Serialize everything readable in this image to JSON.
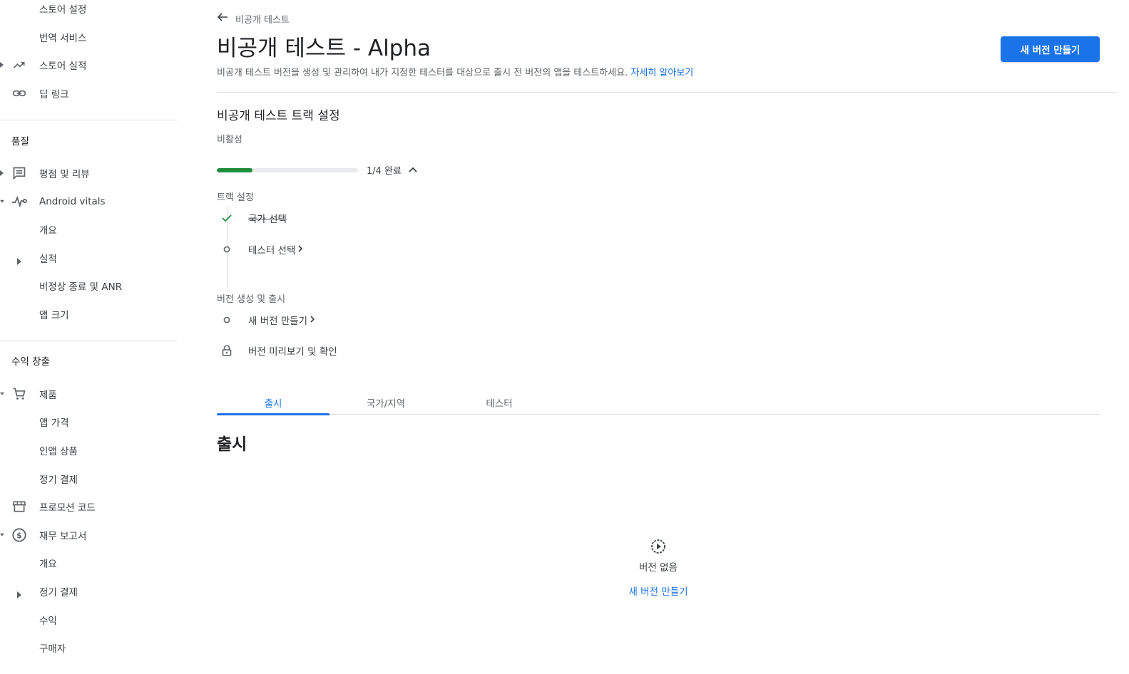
{
  "sidebar": {
    "items": [
      {
        "label": "스토어 설정"
      },
      {
        "label": "번역 서비스"
      },
      {
        "label": "스토어 실적"
      },
      {
        "label": "딥 링크"
      },
      {
        "label": "평점 및 리뷰"
      },
      {
        "label": "Android vitals"
      },
      {
        "label": "개요"
      },
      {
        "label": "실적"
      },
      {
        "label": "비정상 종료 및 ANR"
      },
      {
        "label": "앱 크기"
      },
      {
        "label": "제품"
      },
      {
        "label": "앱 가격"
      },
      {
        "label": "인앱 상품"
      },
      {
        "label": "정기 결제"
      },
      {
        "label": "프로모션 코드"
      },
      {
        "label": "재무 보고서"
      },
      {
        "label": "개요"
      },
      {
        "label": "정기 결제"
      },
      {
        "label": "수익"
      },
      {
        "label": "구매자"
      }
    ],
    "sections": {
      "quality": "품질",
      "monetization": "수익 창출"
    }
  },
  "header": {
    "back_label": "비공개 테스트",
    "title": "비공개 테스트 - Alpha",
    "description": "비공개 테스트 버전을 생성 및 관리하여 내가 지정한 테스터를 대상으로 출시 전 버전의 앱을 테스트하세요.",
    "learn_more": "자세히 알아보기",
    "create_button": "새 버전 만들기"
  },
  "track_setup": {
    "title": "비공개 테스트 트랙 설정",
    "status": "비활성",
    "progress_label": "1/4 완료",
    "progress_fraction": 0.25,
    "groups": [
      {
        "label": "트랙 설정",
        "steps": [
          {
            "label": "국가 선택",
            "state": "done"
          },
          {
            "label": "테스터 선택",
            "state": "pending"
          }
        ]
      },
      {
        "label": "버전 생성 및 출시",
        "steps": [
          {
            "label": "새 버전 만들기",
            "state": "pending"
          },
          {
            "label": "버전 미리보기 및 확인",
            "state": "locked"
          }
        ]
      }
    ]
  },
  "tabs": [
    {
      "label": "출시",
      "active": true
    },
    {
      "label": "국가/지역",
      "active": false
    },
    {
      "label": "테스터",
      "active": false
    }
  ],
  "release": {
    "title": "출시",
    "empty_text": "버전 없음",
    "empty_link": "새 버전 만들기"
  },
  "colors": {
    "accent": "#1a73e8",
    "success": "#1e8e3e"
  }
}
